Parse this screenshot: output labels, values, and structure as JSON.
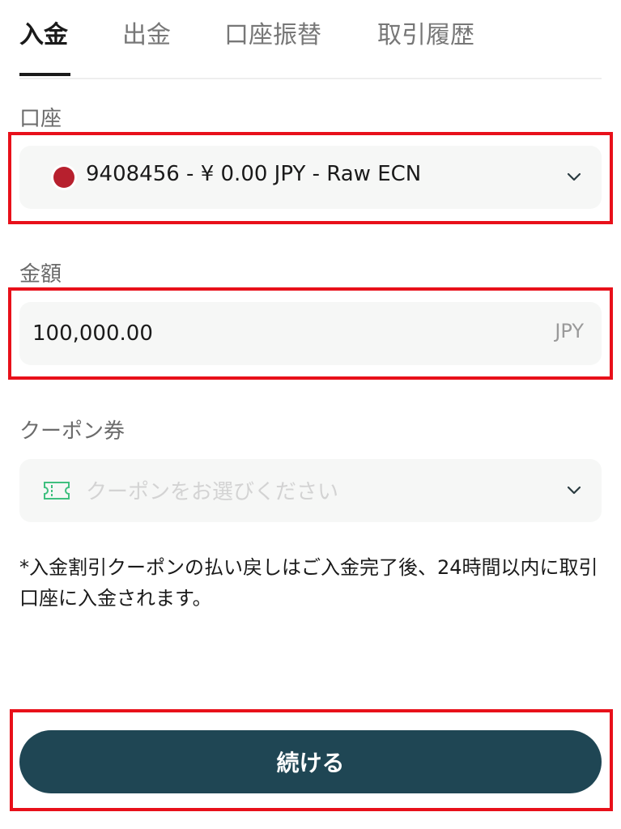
{
  "tabs": [
    {
      "label": "入金",
      "active": true
    },
    {
      "label": "出金",
      "active": false
    },
    {
      "label": "口座振替",
      "active": false
    },
    {
      "label": "取引履歴",
      "active": false
    }
  ],
  "account": {
    "label": "口座",
    "selected": "9408456 - ¥ 0.00 JPY - Raw ECN",
    "flag_color": "#b7202e",
    "icon": "chevron-down-icon"
  },
  "amount": {
    "label": "金額",
    "value": "100,000.00",
    "currency": "JPY"
  },
  "coupon": {
    "label": "クーポン券",
    "placeholder": "クーポンをお選びください",
    "icon": "ticket-icon"
  },
  "note": "*入金割引クーポンの払い戻しはご入金完了後、24時間以内に取引口座に入金されます。",
  "continue_label": "続ける",
  "colors": {
    "accent": "#1f4654",
    "highlight": "#e8101a",
    "coupon_icon": "#3fbf7f"
  }
}
